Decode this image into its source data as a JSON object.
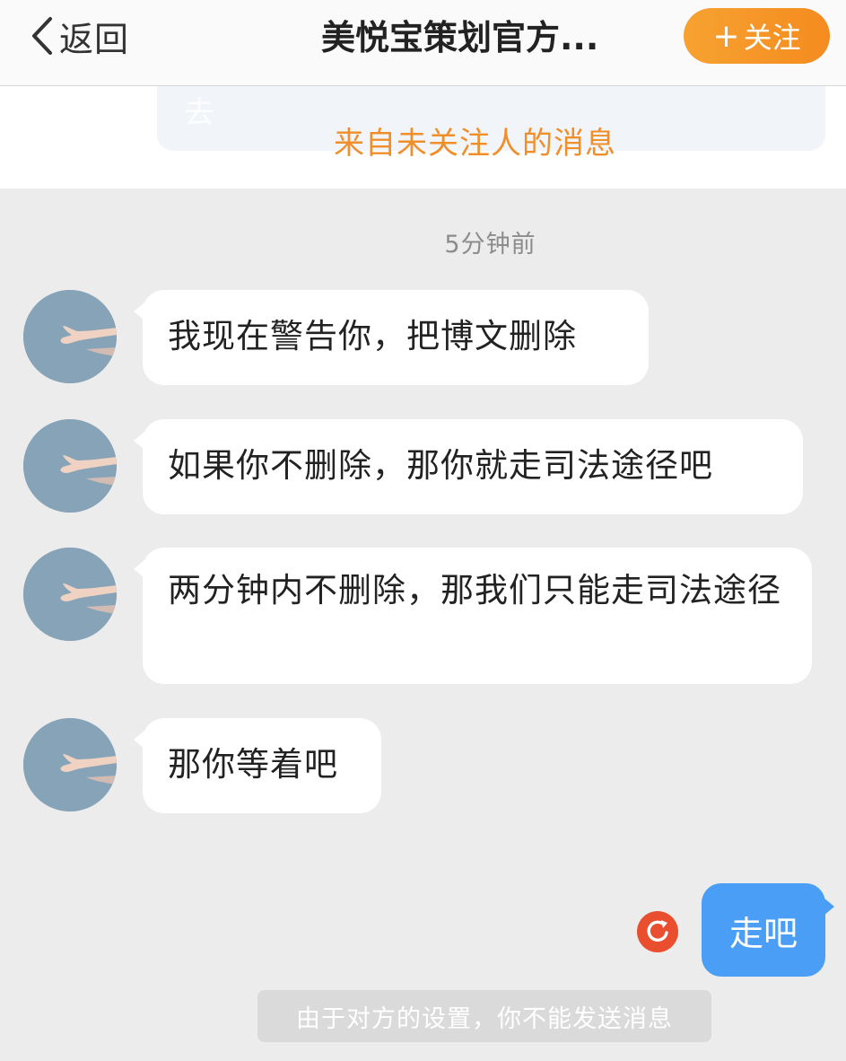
{
  "header": {
    "back_label": "返回",
    "title": "美悦宝策划官方...",
    "follow_label": "关注",
    "follow_plus": "+"
  },
  "notice": {
    "ghost_text": "去",
    "text": "来自未关注人的消息"
  },
  "timestamp": "5分钟前",
  "messages": [
    {
      "sender": "other",
      "text": "我现在警告你，把博文删除"
    },
    {
      "sender": "other",
      "text": "如果你不删除，那你就走司法途径吧"
    },
    {
      "sender": "other",
      "text": "两分钟内不删除，那我们只能走司法途径"
    },
    {
      "sender": "other",
      "text": "那你等着吧"
    }
  ],
  "outgoing": {
    "text": "走吧",
    "status": "failed"
  },
  "system_note": "由于对方的设置，你不能发送消息",
  "colors": {
    "follow_button": "#f58b1f",
    "notice_text": "#f08f2a",
    "outgoing_bubble": "#4a9ef5",
    "resend_icon": "#e94e2f",
    "background": "#ececec"
  },
  "icons": {
    "back": "chevron-left-icon",
    "resend": "refresh-icon",
    "avatar": "hand-photo-avatar"
  }
}
